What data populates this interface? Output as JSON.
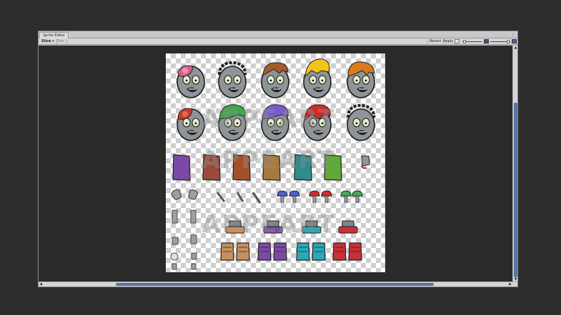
{
  "window": {
    "tab_title": "Sprite Editor",
    "menu_icon": "⋮"
  },
  "toolbar": {
    "slice_label": "Slice ▾",
    "trim_label": "Trim",
    "revert_label": "Revert",
    "apply_label": "Apply"
  },
  "scroll": {
    "up": "▲",
    "down": "▼",
    "left": "◀",
    "right": "▶"
  },
  "watermark": {
    "text": "APPEART"
  },
  "icons": {
    "rgb": "rgb-channel-icon",
    "alpha": "alpha-channel-icon",
    "mip": "mip-level-icon"
  },
  "colors": {
    "skin": "#8e9599",
    "scrollbar": "#5574a8",
    "hair_brown": "#a85a2a",
    "hair_yellow": "#f2c419",
    "hair_orange": "#d97a1e",
    "hair_green": "#3fa84a",
    "hair_purple": "#7a5ad0",
    "hair_red": "#d22a2a",
    "shirt_purple": "#7b4aa6",
    "shirt_brown": "#9a4a3a",
    "shirt_rust": "#a6502a",
    "shirt_tan": "#a87a3a",
    "shirt_teal": "#2e8c8c",
    "shirt_green": "#5fa83a"
  }
}
